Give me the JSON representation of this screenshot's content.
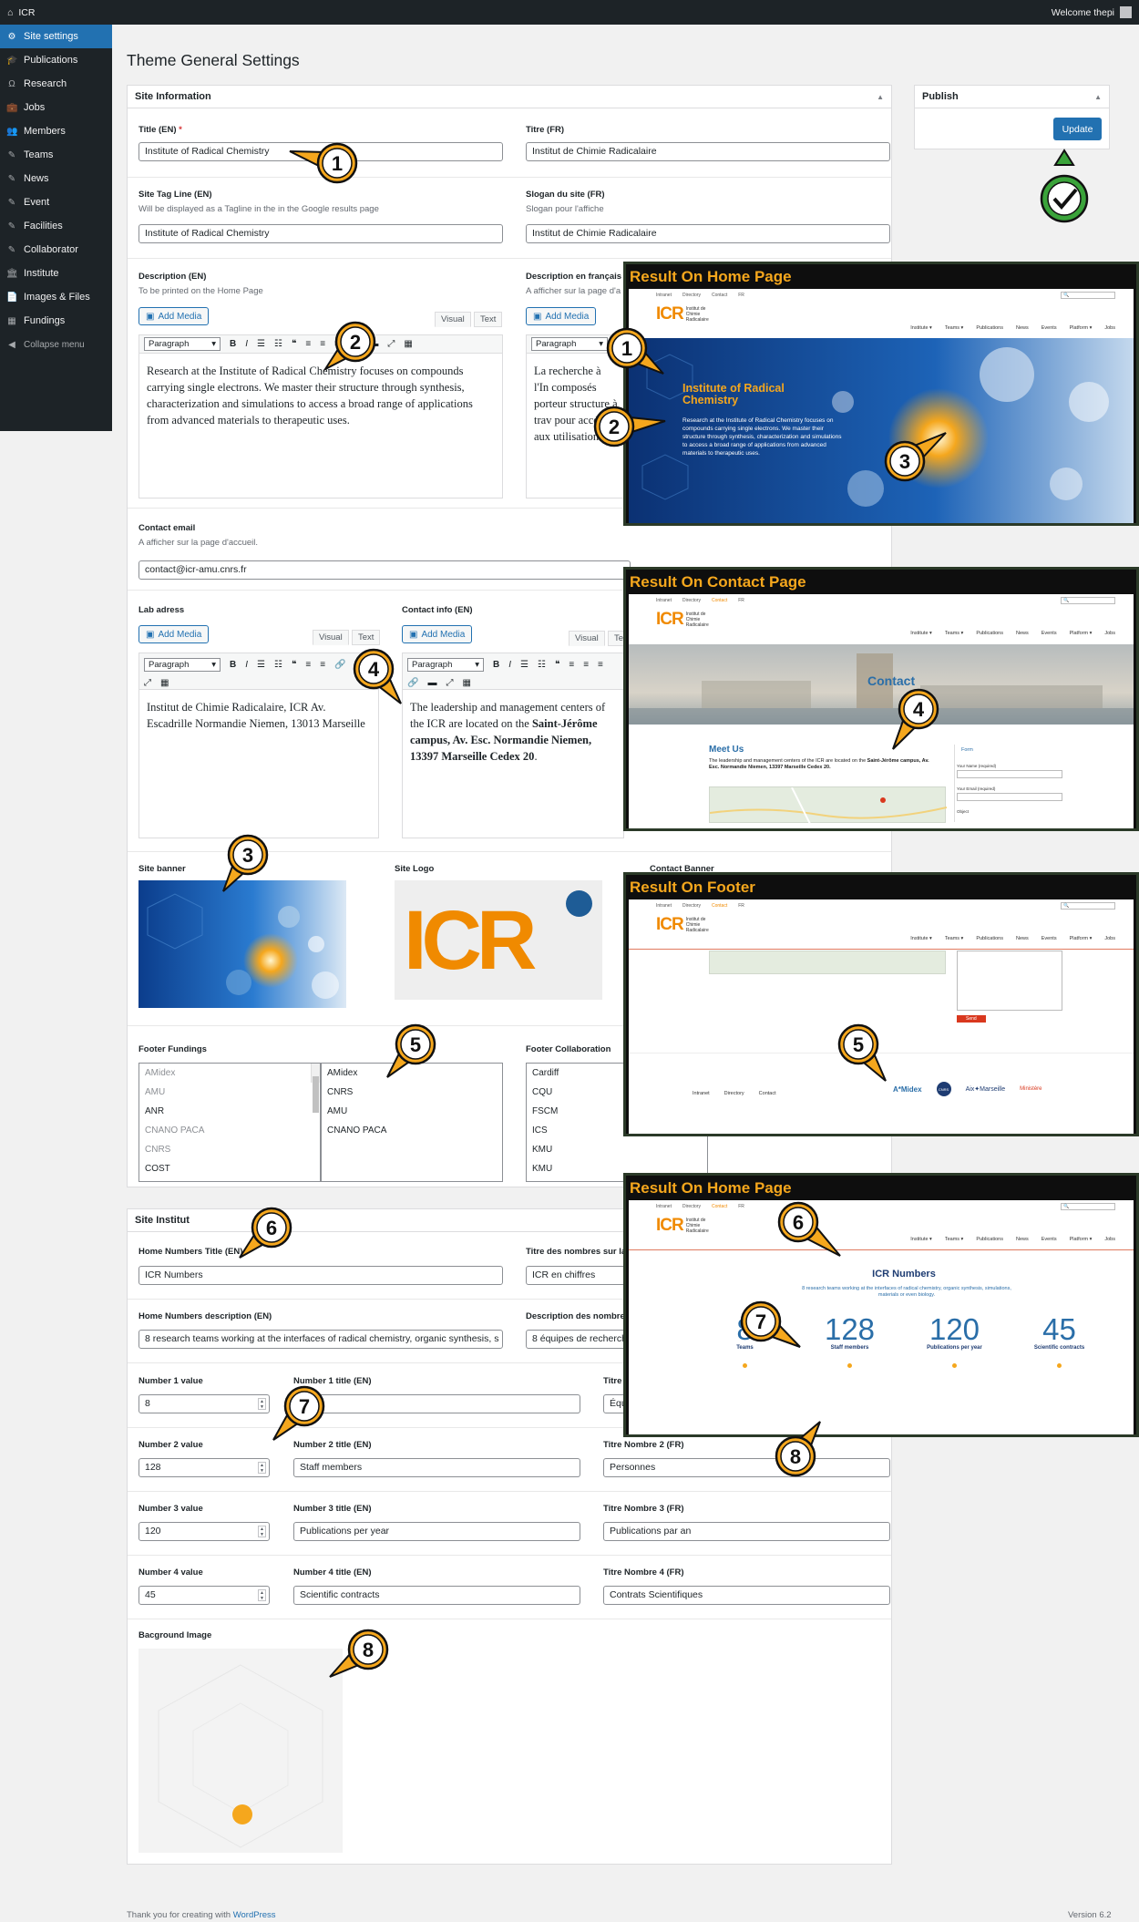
{
  "adminbar": {
    "site": "ICR",
    "welcome": "Welcome thepi"
  },
  "sidebar": {
    "items": [
      {
        "label": "Site settings",
        "icon": "gear-icon",
        "glyph": "⚙"
      },
      {
        "label": "Publications",
        "icon": "graduation-cap-icon",
        "glyph": "🎓"
      },
      {
        "label": "Research",
        "icon": "omega-icon",
        "glyph": "Ω"
      },
      {
        "label": "Jobs",
        "icon": "briefcase-icon",
        "glyph": "💼"
      },
      {
        "label": "Members",
        "icon": "users-icon",
        "glyph": "👥"
      },
      {
        "label": "Teams",
        "icon": "pin-icon",
        "glyph": "✎"
      },
      {
        "label": "News",
        "icon": "pin-icon",
        "glyph": "✎"
      },
      {
        "label": "Event",
        "icon": "pin-icon",
        "glyph": "✎"
      },
      {
        "label": "Facilities",
        "icon": "pin-icon",
        "glyph": "✎"
      },
      {
        "label": "Collaborator",
        "icon": "pin-icon",
        "glyph": "✎"
      },
      {
        "label": "Institute",
        "icon": "bank-icon",
        "glyph": "🏛"
      },
      {
        "label": "Images & Files",
        "icon": "file-icon",
        "glyph": "📄"
      },
      {
        "label": "Fundings",
        "icon": "grid-icon",
        "glyph": "▦"
      }
    ],
    "collapse": "Collapse menu"
  },
  "page_title": "Theme General Settings",
  "site_info": {
    "heading": "Site Information",
    "title_en_label": "Title (EN)",
    "title_en_req": "*",
    "title_en": "Institute of Radical Chemistry",
    "titre_fr_label": "Titre (FR)",
    "titre_fr": "Institut de Chimie Radicalaire",
    "tagline_en_label": "Site Tag Line (EN)",
    "tagline_en_help": "Will be displayed as a Tagline in the in the Google results page",
    "tagline_en": "Institute of Radical Chemistry",
    "slogan_fr_label": "Slogan du site (FR)",
    "slogan_fr_help": "Slogan pour l'affiche",
    "slogan_fr": "Institut de Chimie Radicalaire",
    "desc_en_label": "Description (EN)",
    "desc_en_help": "To be printed on the Home Page",
    "desc_fr_label": "Description en français",
    "desc_fr_help": "A afficher sur la page d'a",
    "add_media": "Add Media",
    "visual": "Visual",
    "text": "Text",
    "paragraph": "Paragraph",
    "desc_en_text": "Research at the Institute of Radical Chemistry focuses on compounds carrying single electrons. We master their structure through synthesis, characterization and simulations to access a broad range of applications from advanced materials to therapeutic uses.",
    "desc_fr_text": "La recherche à l'In composés porteur structure à trav pour accéder aux utilisation",
    "contact_email_label": "Contact email",
    "contact_email_help": "A afficher sur la page d'accueil.",
    "contact_email": "contact@icr-amu.cnrs.fr",
    "lab_address_label": "Lab adress",
    "lab_address_text": "Institut de Chimie Radicalaire, ICR Av. Escadrille Normandie Niemen, 13013 Marseille",
    "contact_info_label": "Contact info (EN)",
    "contact_info_pre": "The leadership and management centers of the ICR are located on the",
    "contact_info_bold": "Saint-Jérôme campus, Av. Esc. Normandie Niemen, 13397 Marseille Cedex 20",
    "contact_info_end": ".",
    "site_banner_label": "Site banner",
    "site_logo_label": "Site Logo",
    "contact_banner_label": "Contact Banner",
    "logo_text": "ICR",
    "footer_fundings_label": "Footer Fundings",
    "fundings_available": [
      "AMidex",
      "AMU",
      "ANR",
      "CNANO PACA",
      "CNRS",
      "COST"
    ],
    "fundings_selected": [
      "AMidex",
      "CNRS",
      "AMU",
      "CNANO PACA"
    ],
    "footer_collab_label": "Footer Collaboration",
    "collab_list": [
      "Cardiff",
      "CQU",
      "FSCM",
      "ICS",
      "KMU",
      "KMU"
    ]
  },
  "publish": {
    "heading": "Publish",
    "update": "Update"
  },
  "site_institut": {
    "heading": "Site Institut",
    "numbers_title_en_label": "Home Numbers Title (EN)",
    "numbers_title_en": "ICR Numbers",
    "numbers_title_fr_label": "Titre des nombres sur la",
    "numbers_title_fr": "ICR en chiffres",
    "numbers_desc_en_label": "Home Numbers description (EN)",
    "numbers_desc_en": "8 research teams working at the interfaces of radical chemistry, organic synthesis, s",
    "numbers_desc_fr_label": "Description des nombre",
    "numbers_desc_fr": "8 équipes de recherch",
    "numbers": [
      {
        "value_label": "Number 1 value",
        "value": "8",
        "title_en_label": "Number 1 title (EN)",
        "title_en": "",
        "title_fr_label": "Titre",
        "title_fr": "Équ"
      },
      {
        "value_label": "Number 2 value",
        "value": "128",
        "title_en_label": "Number 2 title (EN)",
        "title_en": "Staff members",
        "title_fr_label": "Titre Nombre 2 (FR)",
        "title_fr": "Personnes"
      },
      {
        "value_label": "Number 3 value",
        "value": "120",
        "title_en_label": "Number 3 title (EN)",
        "title_en": "Publications per year",
        "title_fr_label": "Titre Nombre 3 (FR)",
        "title_fr": "Publications par an"
      },
      {
        "value_label": "Number 4 value",
        "value": "45",
        "title_en_label": "Number 4 title (EN)",
        "title_en": "Scientific contracts",
        "title_fr_label": "Titre Nombre 4 (FR)",
        "title_fr": "Contrats Scientifiques"
      }
    ],
    "bg_image_label": "Bacground Image"
  },
  "panels": {
    "home1": {
      "title": "Result On Home Page",
      "nav": [
        "Intranet",
        "Directory",
        "Contact",
        "FR"
      ],
      "logo_sub": [
        "Institut de",
        "Chimie",
        "Radicalaire"
      ],
      "menu": [
        "Institute ▾",
        "Teams ▾",
        "Publications",
        "News",
        "Events",
        "Platform ▾",
        "Jobs"
      ],
      "hero_title": "Institute of Radical Chemistry",
      "hero_text": "Research at the Institute of Radical Chemistry focuses on compounds carrying single electrons. We master their structure through synthesis, characterization and simulations to access a broad range of applications from advanced materials to therapeutic uses."
    },
    "contact": {
      "title": "Result On Contact Page",
      "banner_title": "Contact",
      "meet_us": "Meet Us",
      "meet_pre": "The leadership and management centers of the ICR are located on the ",
      "meet_bold": "Saint-Jérôme campus, Av. Esc. Normandie Niemen, 13397 Marseille Cedex 20.",
      "form_title": "Form",
      "name_label": "Your Name (required)",
      "email_label": "Your Email (required)",
      "subject_label": "Object"
    },
    "footer": {
      "title": "Result On  Footer",
      "send": "Send",
      "links": [
        "Intranet",
        "Directory",
        "Contact"
      ],
      "logos": [
        "A*Midex",
        "CNRS",
        "Aix✦Marseille",
        "Ministère"
      ]
    },
    "home2": {
      "title": "Result On Home Page",
      "numbers_title": "ICR Numbers",
      "numbers_desc": "8 research teams working at the interfaces of radical chemistry, organic synthesis, simulations, materials or even biology.",
      "stats": [
        {
          "value": "8",
          "label": "Teams"
        },
        {
          "value": "128",
          "label": "Staff members"
        },
        {
          "value": "120",
          "label": "Publications per year"
        },
        {
          "value": "45",
          "label": "Scientific contracts"
        }
      ]
    }
  },
  "annotations": [
    "1",
    "2",
    "3",
    "4",
    "5",
    "6",
    "7",
    "8"
  ],
  "footer": {
    "thanks": "Thank you for creating with ",
    "wp": "WordPress",
    "version": "Version 6.2"
  },
  "colors": {
    "accent": "#2271b1",
    "admin_dark": "#1d2327",
    "callout": "#f5a71d",
    "icr_blue": "#2a6ea8",
    "icr_orange": "#f08a00",
    "icr_red": "#d9381e",
    "check_green": "#3aa33a"
  }
}
